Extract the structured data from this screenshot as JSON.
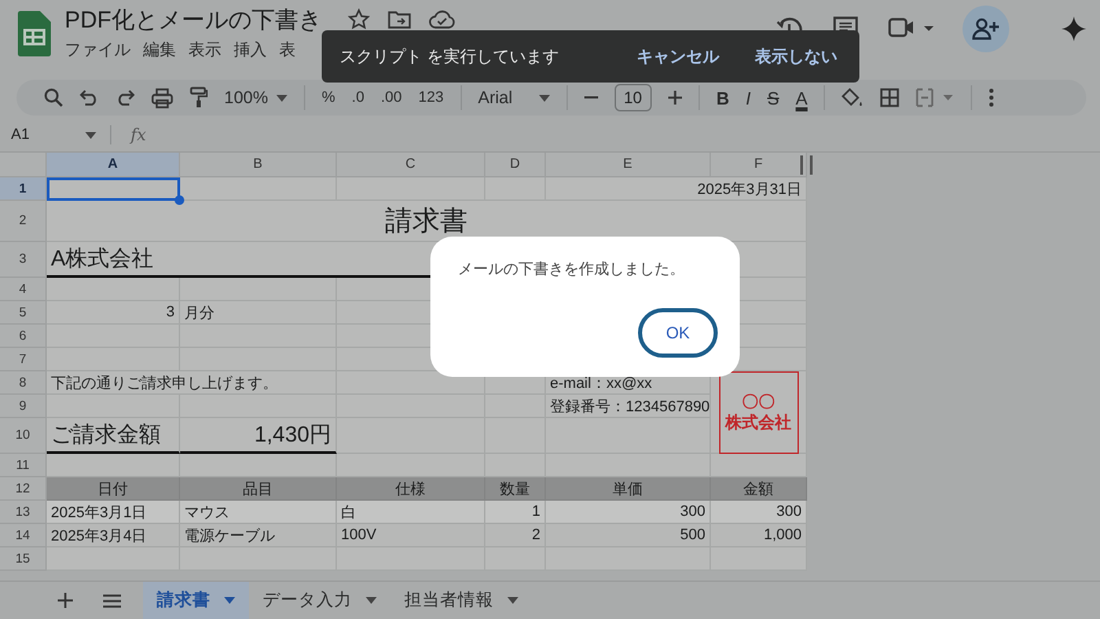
{
  "app": {
    "title": "PDF化とメールの下書き",
    "menu": [
      "ファイル",
      "編集",
      "表示",
      "挿入",
      "表"
    ]
  },
  "toolbar": {
    "zoom": "100%",
    "number_formats": [
      "%",
      ".0",
      ".00",
      "123"
    ],
    "font": "Arial",
    "font_size": "10",
    "text_styles": [
      "B",
      "I",
      "S",
      "A"
    ]
  },
  "formula_bar": {
    "name_box": "A1",
    "label": "fx"
  },
  "sheet": {
    "columns": [
      {
        "label": "A",
        "selected": true
      },
      {
        "label": "B",
        "selected": false
      },
      {
        "label": "C",
        "selected": false
      },
      {
        "label": "D",
        "selected": false
      },
      {
        "label": "E",
        "selected": false
      },
      {
        "label": "F",
        "selected": false
      }
    ],
    "rows": [
      {
        "label": "1",
        "selected": true,
        "cells": {
          "E:F": {
            "kind": "date",
            "text": "2025年3月31日"
          }
        }
      },
      {
        "label": "2",
        "selected": false,
        "cells": {
          "A:F": {
            "kind": "title",
            "text": "請求書"
          }
        }
      },
      {
        "label": "3",
        "selected": false,
        "cells": {
          "A:C": {
            "kind": "large",
            "underline": true,
            "text": "A株式会社"
          }
        }
      },
      {
        "label": "4",
        "selected": false
      },
      {
        "label": "5",
        "selected": false,
        "cells": {
          "A": {
            "kind": "number",
            "text": "3"
          },
          "B": {
            "kind": "plain",
            "text": "月分"
          }
        }
      },
      {
        "label": "6",
        "selected": false
      },
      {
        "label": "7",
        "selected": false
      },
      {
        "label": "8",
        "selected": false,
        "cells": {
          "A:B": {
            "kind": "plain",
            "text": "下記の通りご請求申し上げます。"
          },
          "E": {
            "kind": "plain",
            "text": "e-mail：xx@xx"
          },
          "F": {
            "kind": "stamp",
            "lines": [
              "〇〇",
              "株式会社"
            ]
          }
        }
      },
      {
        "label": "9",
        "selected": false,
        "cells": {
          "E": {
            "kind": "plain",
            "text": "登録番号：1234567890"
          }
        }
      },
      {
        "label": "10",
        "selected": false,
        "cells": {
          "A": {
            "kind": "large",
            "underline": true,
            "text": "ご請求金額"
          },
          "B": {
            "kind": "large_number",
            "underline": true,
            "text": "1,430円"
          }
        }
      },
      {
        "label": "11",
        "selected": false
      },
      {
        "label": "12",
        "selected": false,
        "cells": {
          "A": {
            "kind": "header",
            "text": "日付"
          },
          "B": {
            "kind": "header",
            "text": "品目"
          },
          "C": {
            "kind": "header",
            "text": "仕様"
          },
          "D": {
            "kind": "header",
            "text": "数量"
          },
          "E": {
            "kind": "header",
            "text": "単価"
          },
          "F": {
            "kind": "header",
            "text": "金額"
          }
        }
      },
      {
        "label": "13",
        "selected": false,
        "cells": {
          "A": {
            "kind": "item",
            "text": "2025年3月1日"
          },
          "B": {
            "kind": "item",
            "text": "マウス"
          },
          "C": {
            "kind": "item",
            "text": "白"
          },
          "D": {
            "kind": "item_number",
            "text": "1"
          },
          "E": {
            "kind": "item_number",
            "text": "300"
          },
          "F": {
            "kind": "item_number",
            "text": "300"
          }
        }
      },
      {
        "label": "14",
        "selected": false,
        "cells": {
          "A": {
            "kind": "item",
            "text": "2025年3月4日"
          },
          "B": {
            "kind": "item",
            "text": "電源ケーブル"
          },
          "C": {
            "kind": "item",
            "text": "100V"
          },
          "D": {
            "kind": "item_number",
            "text": "2"
          },
          "E": {
            "kind": "item_number",
            "text": "500"
          },
          "F": {
            "kind": "item_number",
            "text": "1,000"
          }
        }
      },
      {
        "label": "15",
        "selected": false
      }
    ]
  },
  "sheet_tabs": [
    {
      "label": "請求書",
      "selected": true
    },
    {
      "label": "データ入力",
      "selected": false
    },
    {
      "label": "担当者情報",
      "selected": false
    }
  ],
  "toast": {
    "message": "スクリプト を実行しています",
    "actions": [
      "キャンセル",
      "表示しない"
    ]
  },
  "dialog": {
    "message": "メールの下書きを作成しました。",
    "button": "OK"
  }
}
